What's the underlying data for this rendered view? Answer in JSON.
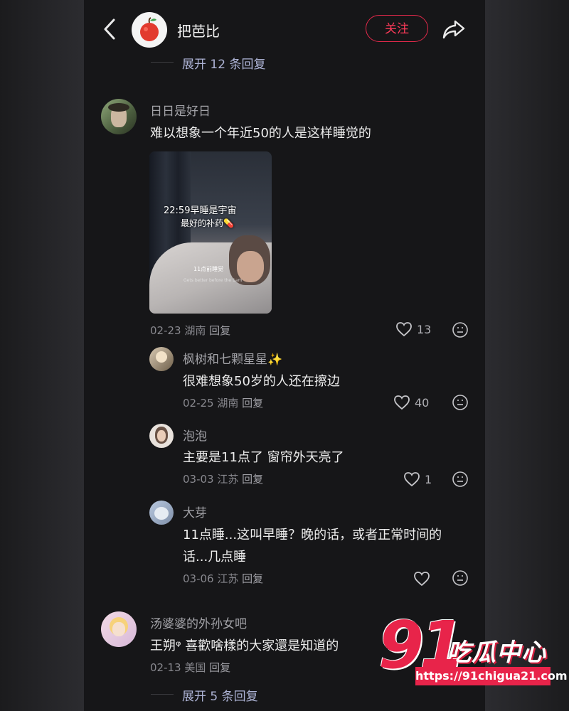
{
  "header": {
    "title": "把芭比",
    "follow_label": "关注"
  },
  "top_expand": "展开 12 条回复",
  "comments": [
    {
      "name": "日日是好日",
      "text": "难以想象一个年近50的人是这样睡觉的",
      "photo": {
        "caption_line1": "22:59早睡是宇宙",
        "caption_line2": "最好的补药💊",
        "small_caption": "11点前睡觉",
        "tiny_caption": "Gets better before the 1am"
      },
      "date": "02-23",
      "location": "湖南",
      "reply_label": "回复",
      "likes": "13",
      "replies": [
        {
          "name": "枫树和七颗星星✨",
          "text": "很难想象50岁的人还在擦边",
          "date": "02-25",
          "location": "湖南",
          "reply_label": "回复",
          "likes": "40"
        },
        {
          "name": "泡泡",
          "text": "主要是11点了 窗帘外天亮了",
          "date": "03-03",
          "location": "江苏",
          "reply_label": "回复",
          "likes": "1"
        },
        {
          "name": "大芽",
          "text_line1": "11点睡...这叫早睡？晚的话，或者正常时间的",
          "text_line2": "话...几点睡",
          "date": "03-06",
          "location": "江苏",
          "reply_label": "回复",
          "likes": ""
        }
      ]
    },
    {
      "name": "汤婆婆的外孙女吧",
      "text": "王朔ᵠ 喜歡啥樣的大家還是知道的",
      "date": "02-13",
      "location": "美国",
      "reply_label": "回复",
      "expand": "展开 5 条回复"
    }
  ],
  "watermark": {
    "number": "91",
    "brand": "吃瓜中心",
    "url": "https://91chigua21.com"
  },
  "colors": {
    "background": "#161618",
    "accent": "#e0294a",
    "expand_link": "#aeb4d6"
  }
}
